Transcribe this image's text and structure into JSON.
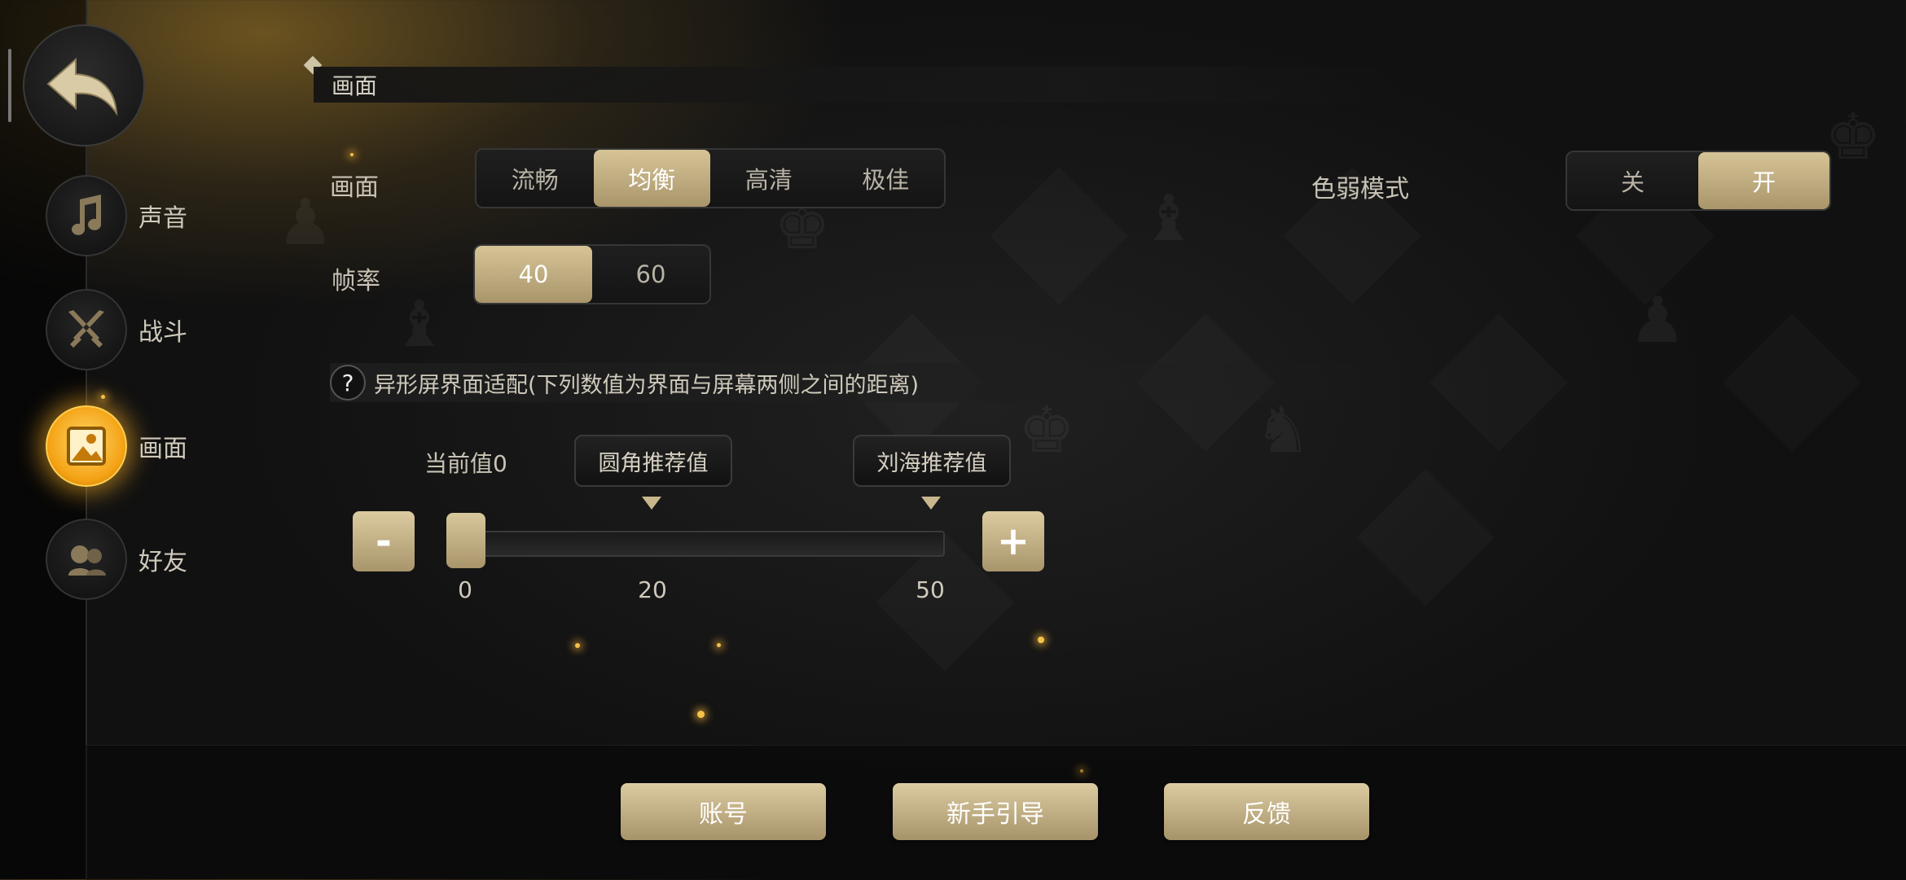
{
  "colors": {
    "accent_gold": "#c8b68c",
    "active_icon": "#f4a214"
  },
  "sidebar": {
    "back_icon": "back-arrow-icon",
    "items": [
      {
        "label": "声音",
        "icon": "music-note-icon",
        "active": false
      },
      {
        "label": "战斗",
        "icon": "crossed-swords-icon",
        "active": false
      },
      {
        "label": "画面",
        "icon": "picture-icon",
        "active": true
      },
      {
        "label": "好友",
        "icon": "friends-icon",
        "active": false
      }
    ]
  },
  "section": {
    "title": "画面"
  },
  "quality": {
    "label": "画面",
    "options": [
      "流畅",
      "均衡",
      "高清",
      "极佳"
    ],
    "selected": "均衡"
  },
  "framerate": {
    "label": "帧率",
    "options": [
      "40",
      "60"
    ],
    "selected": "40"
  },
  "colorblind": {
    "label": "色弱模式",
    "options": [
      "关",
      "开"
    ],
    "selected": "开"
  },
  "adapt": {
    "help_symbol": "?",
    "text": "异形屏界面适配(下列数值为界面与屏幕两侧之间的距离)",
    "current_value_text": "当前值0",
    "rounded_label": "圆角推荐值",
    "notch_label": "刘海推荐值",
    "minus_symbol": "-",
    "plus_symbol": "+",
    "slider_value": 0,
    "slider_max": 50,
    "ticks": [
      "0",
      "20",
      "50"
    ]
  },
  "bottom": {
    "account": "账号",
    "guide": "新手引导",
    "feedback": "反馈"
  }
}
